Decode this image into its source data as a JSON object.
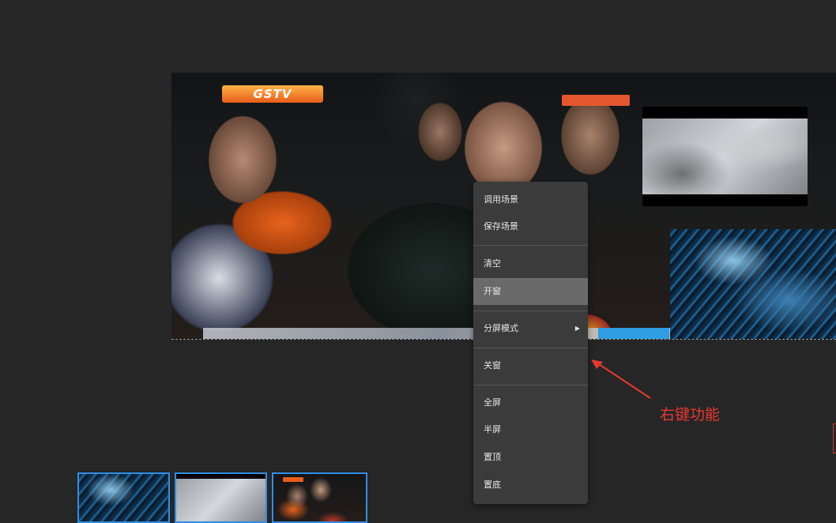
{
  "video_wall": {
    "main_video": {
      "logo_text": "GSTV"
    }
  },
  "context_menu": {
    "items": [
      {
        "label": "调用场景"
      },
      {
        "label": "保存场景"
      },
      {
        "label": "清空"
      },
      {
        "label": "开窗",
        "active": true
      },
      {
        "label": "分屏模式",
        "has_submenu": true,
        "submenu_icon": "triangle-right-icon"
      },
      {
        "label": "关窗"
      },
      {
        "label": "全屏"
      },
      {
        "label": "半屏"
      },
      {
        "label": "置顶"
      },
      {
        "label": "置底"
      }
    ]
  },
  "annotation": {
    "text": "右键功能",
    "color": "#e8382f"
  },
  "thumbnails": [
    {
      "name": "water"
    },
    {
      "name": "snow"
    },
    {
      "name": "people"
    }
  ],
  "colors": {
    "background": "#262626",
    "menu_bg": "#3b3b3b",
    "menu_active": "#6a6a6a",
    "thumb_border": "#2e8ee6"
  }
}
